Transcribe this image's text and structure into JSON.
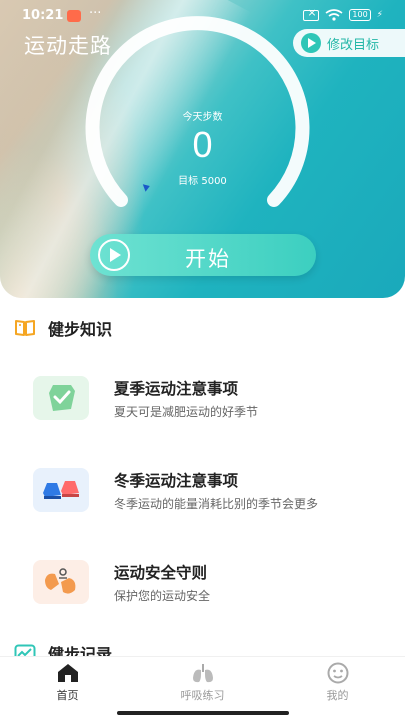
{
  "status_bar": {
    "time": "10:21",
    "more": "···",
    "battery": "100"
  },
  "hero": {
    "title": "运动走路",
    "edit_goal_label": "修改目标",
    "steps_label": "今天步数",
    "steps_value": "0",
    "goal_text": "目标 5000",
    "start_label": "开始"
  },
  "knowledge": {
    "heading": "健步知识",
    "items": [
      {
        "title": "夏季运动注意事项",
        "subtitle": "夏天可是减肥运动的好季节",
        "icon": "shield-check-icon"
      },
      {
        "title": "冬季运动注意事项",
        "subtitle": "冬季运动的能量消耗比别的季节会更多",
        "icon": "sneakers-icon"
      },
      {
        "title": "运动安全守则",
        "subtitle": "保护您的运动安全",
        "icon": "gloves-icon"
      }
    ]
  },
  "records": {
    "heading": "健步记录"
  },
  "nav": {
    "tabs": [
      {
        "label": "首页",
        "icon": "home-icon",
        "active": true
      },
      {
        "label": "呼吸练习",
        "icon": "lungs-icon",
        "active": false
      },
      {
        "label": "我的",
        "icon": "profile-icon",
        "active": false
      }
    ]
  },
  "colors": {
    "accent": "#2fc6b7",
    "hero_teal": "#1fb3bf",
    "section_icon": "#f5a623"
  }
}
